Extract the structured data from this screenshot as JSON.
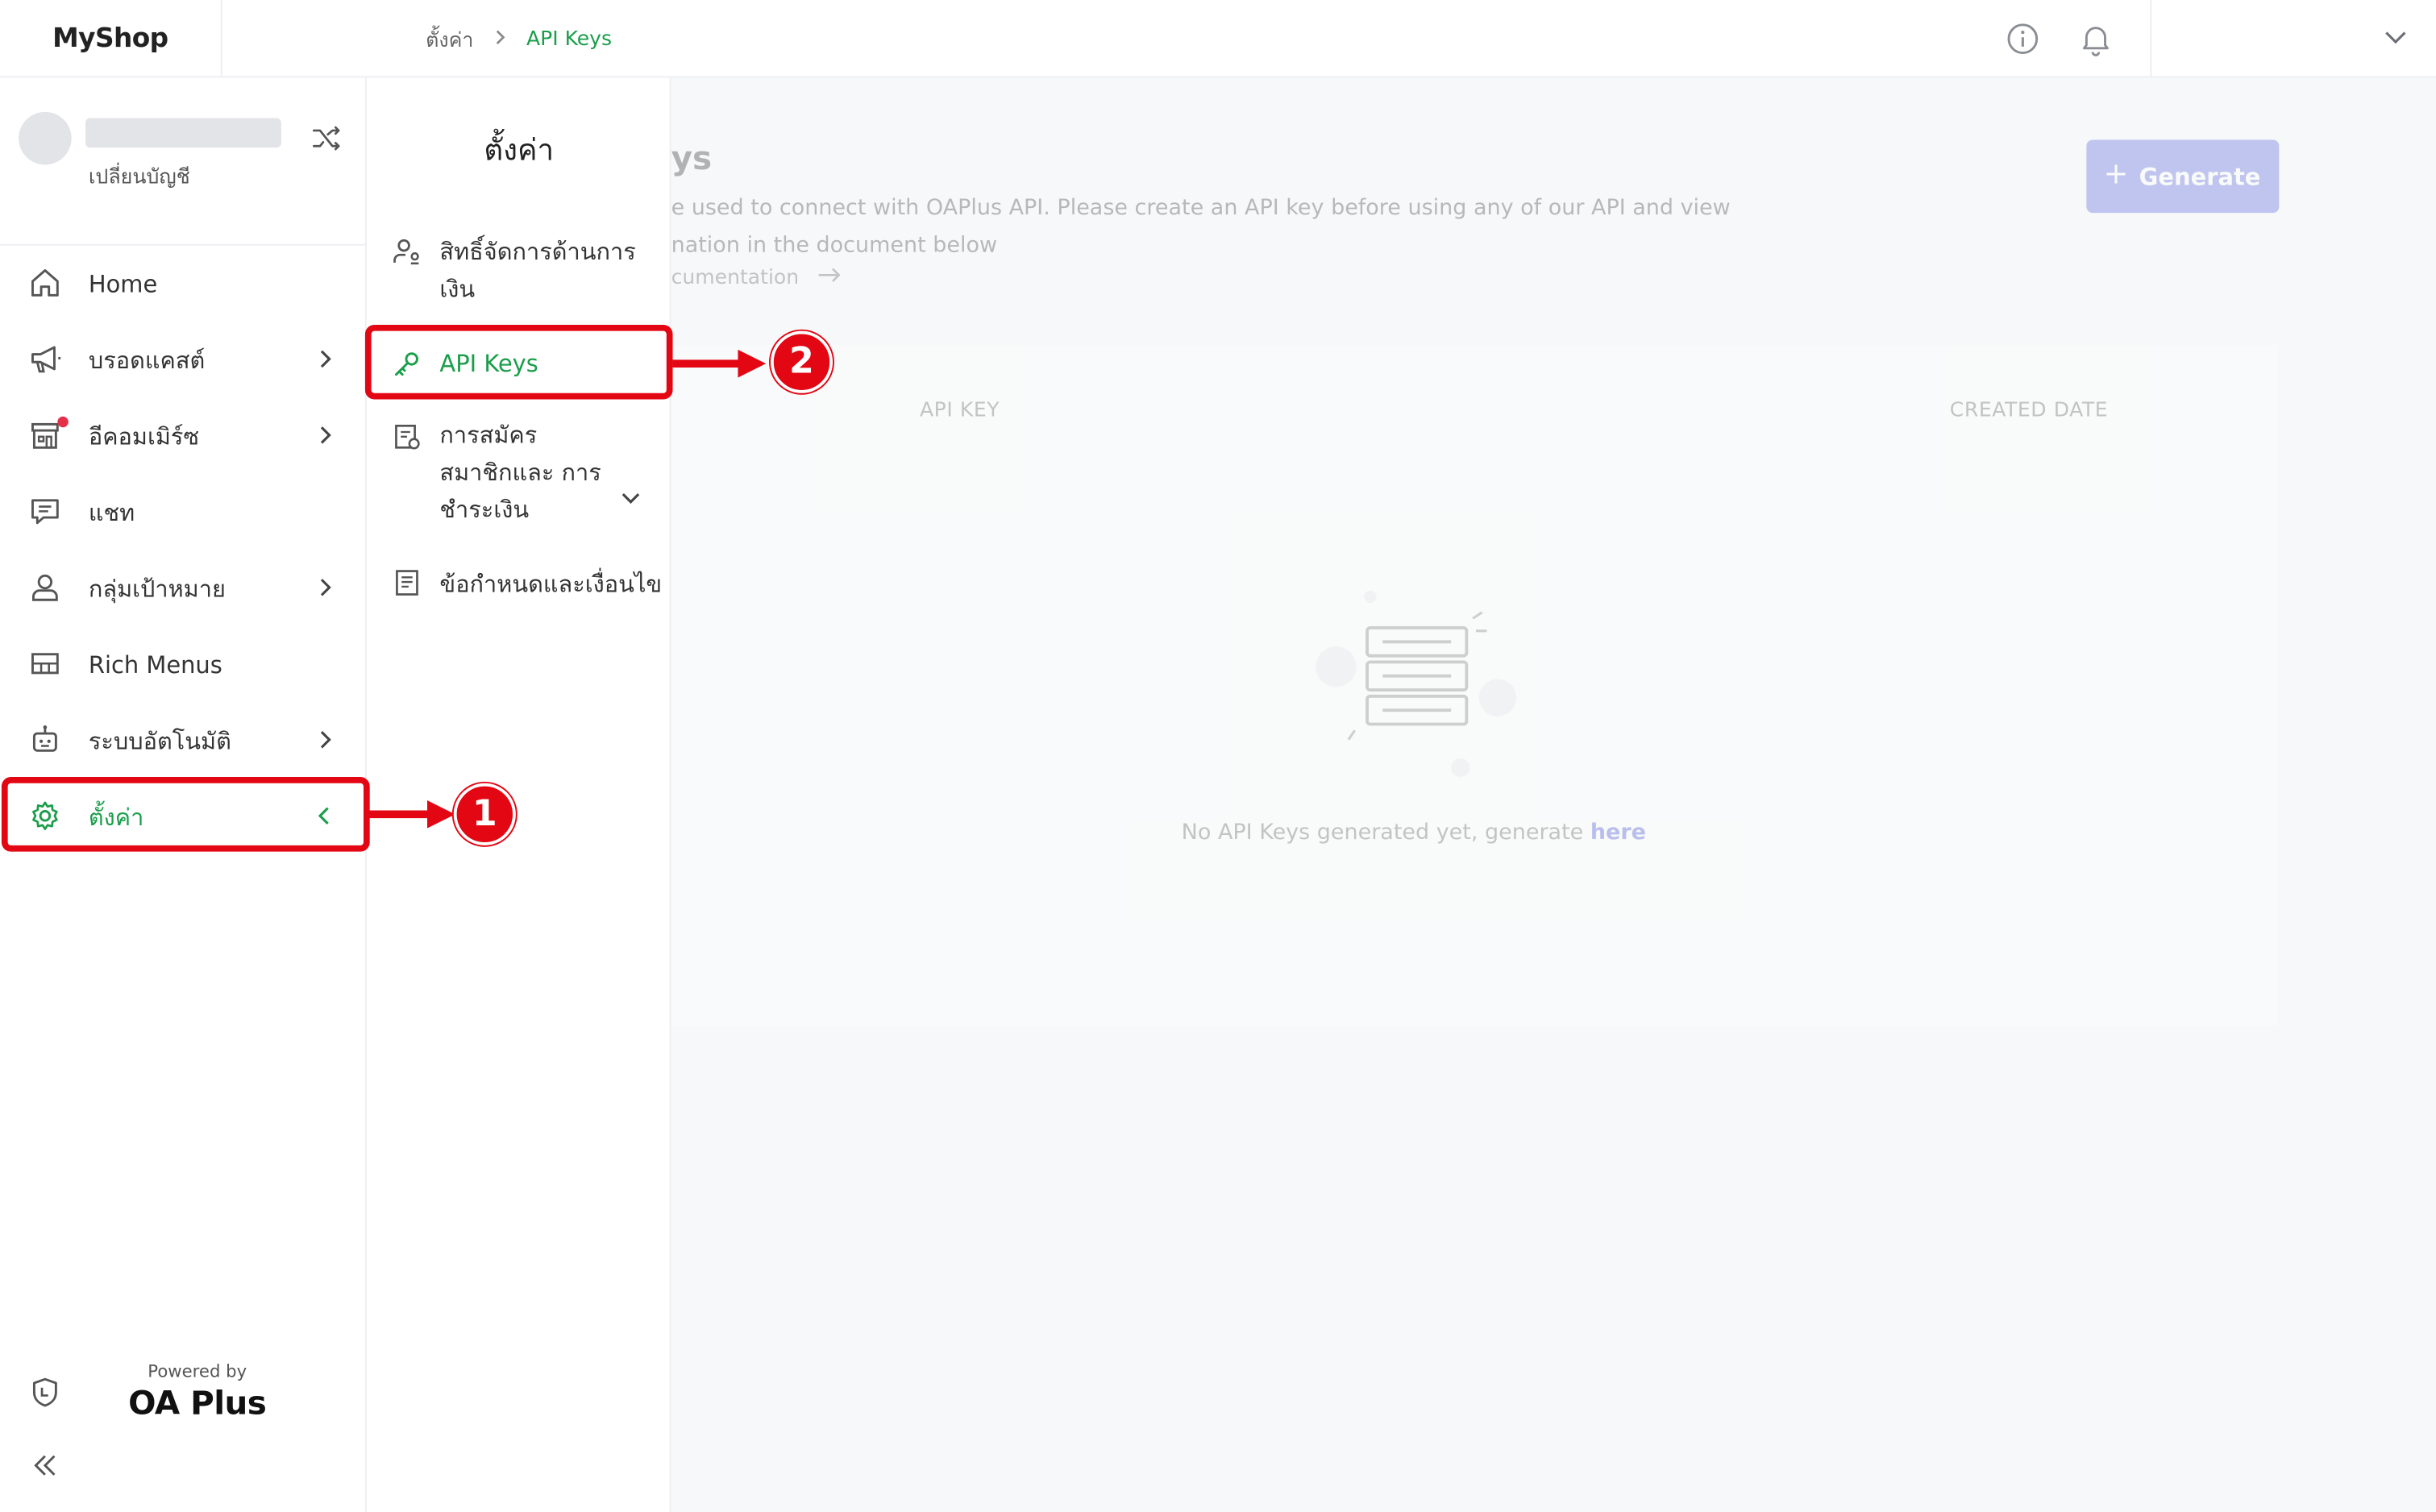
{
  "header": {
    "logo": "MyShop",
    "breadcrumb": [
      "ตั้งค่า",
      "API Keys"
    ],
    "icons": [
      "info-icon",
      "bell-icon",
      "chevron-down-icon"
    ]
  },
  "sidebar": {
    "switch_account_label": "เปลี่ยนบัญชี",
    "items": [
      {
        "label": "Home",
        "icon": "home-icon"
      },
      {
        "label": "บรอดแคสต์",
        "icon": "megaphone-icon"
      },
      {
        "label": "อีคอมเมิร์ซ",
        "icon": "store-icon"
      },
      {
        "label": "แชท",
        "icon": "chat-icon"
      },
      {
        "label": "กลุ่มเป้าหมาย",
        "icon": "user-icon"
      },
      {
        "label": "Rich Menus",
        "icon": "layout-icon"
      },
      {
        "label": "ระบบอัตโนมัติ",
        "icon": "robot-icon"
      },
      {
        "label": "ตั้งค่า",
        "icon": "gear-icon"
      }
    ],
    "powered_by": "Powered by",
    "brand": "OA Plus"
  },
  "submenu": {
    "title": "ตั้งค่า",
    "items": [
      {
        "label_line1": "สิทธิ์จัดการด้านการ",
        "label_line2": "เงิน",
        "icon": "user-permission-icon"
      },
      {
        "label": "API Keys",
        "icon": "key-icon"
      },
      {
        "label_line1": "การสมัคร",
        "label_line2": "สมาชิกและ การ",
        "label_line3": "ชำระเงิน",
        "icon": "receipt-icon"
      },
      {
        "label": "ข้อกำหนดและเงื่อนไข",
        "icon": "document-icon"
      }
    ]
  },
  "main": {
    "title_visible": "ys",
    "desc_line1": "e used to connect with OAPlus API. Please create an API key before using any of our API and view",
    "desc_line2": "nation in the document below",
    "doc_link": "cumentation",
    "generate_label": "Generate",
    "table_headers": [
      "API KEY",
      "CREATED DATE"
    ],
    "empty_text": "No API Keys generated yet, generate ",
    "empty_link": "here"
  },
  "annotations": [
    {
      "number": "1"
    },
    {
      "number": "2"
    }
  ],
  "colors": {
    "accent_green": "#1a9e4a",
    "callout_red": "#e30613",
    "generate_blue": "#4c5bd9"
  }
}
